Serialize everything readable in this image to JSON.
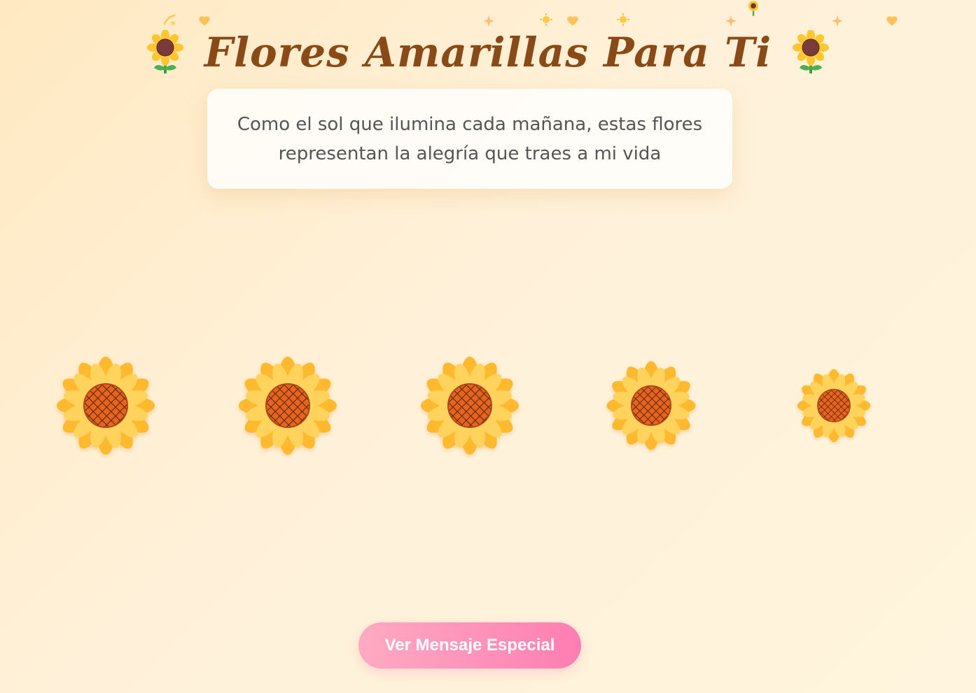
{
  "header": {
    "title": "Flores Amarillas Para Ti",
    "left_icon": "sunflower-icon",
    "right_icon": "sunflower-icon"
  },
  "message": {
    "line1": "Como el sol que ilumina cada mañana, estas flores",
    "line2": "representan la alegría que traes a mi vida"
  },
  "floating_decorations": [
    "shooting-star-icon",
    "heart-icon",
    "sparkles-icon",
    "sun-icon",
    "heart-icon",
    "sun-icon",
    "sparkles-icon",
    "sunflower-icon",
    "sparkles-icon",
    "heart-icon"
  ],
  "flowers": [
    {
      "name": "sunflower-1",
      "icon": "sunflower-icon"
    },
    {
      "name": "sunflower-2",
      "icon": "sunflower-icon"
    },
    {
      "name": "sunflower-3",
      "icon": "sunflower-icon"
    },
    {
      "name": "sunflower-4",
      "icon": "sunflower-icon"
    },
    {
      "name": "sunflower-5",
      "icon": "sunflower-icon"
    }
  ],
  "button": {
    "label": "Ver Mensaje Especial"
  },
  "colors": {
    "background_start": "#ffe9c2",
    "background_end": "#fff4dd",
    "title": "#8a4a17",
    "petal": "#ffb92e",
    "petal_light": "#ffd35c",
    "center": "#e8641c",
    "center_grid": "#5a2a12",
    "button_start": "#ffaac2",
    "button_end": "#ff7eb2"
  }
}
